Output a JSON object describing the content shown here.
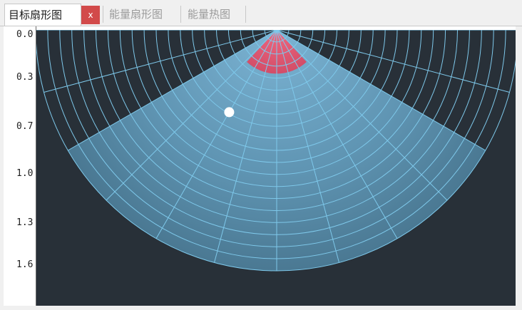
{
  "tabs": [
    {
      "label": "目标扇形图",
      "active": true
    },
    {
      "label": "能量扇形图",
      "active": false
    },
    {
      "label": "能量热图",
      "active": false
    }
  ],
  "close_label": "x",
  "y_axis_labels": [
    "0.0",
    "0.3",
    "0.7",
    "1.0",
    "1.3",
    "1.6"
  ],
  "colors": {
    "plot_background": "#283038",
    "grid_line": "#7ec8ea",
    "sector_fill": "#6ea8c8",
    "target_zone": "#e0506a",
    "target_point": "#ffffff",
    "close_button": "#d24a4a"
  },
  "sector": {
    "half_angle_deg": 60,
    "target_zone_range": 0.3
  },
  "target": {
    "range": 0.6,
    "angle_deg": -30
  }
}
